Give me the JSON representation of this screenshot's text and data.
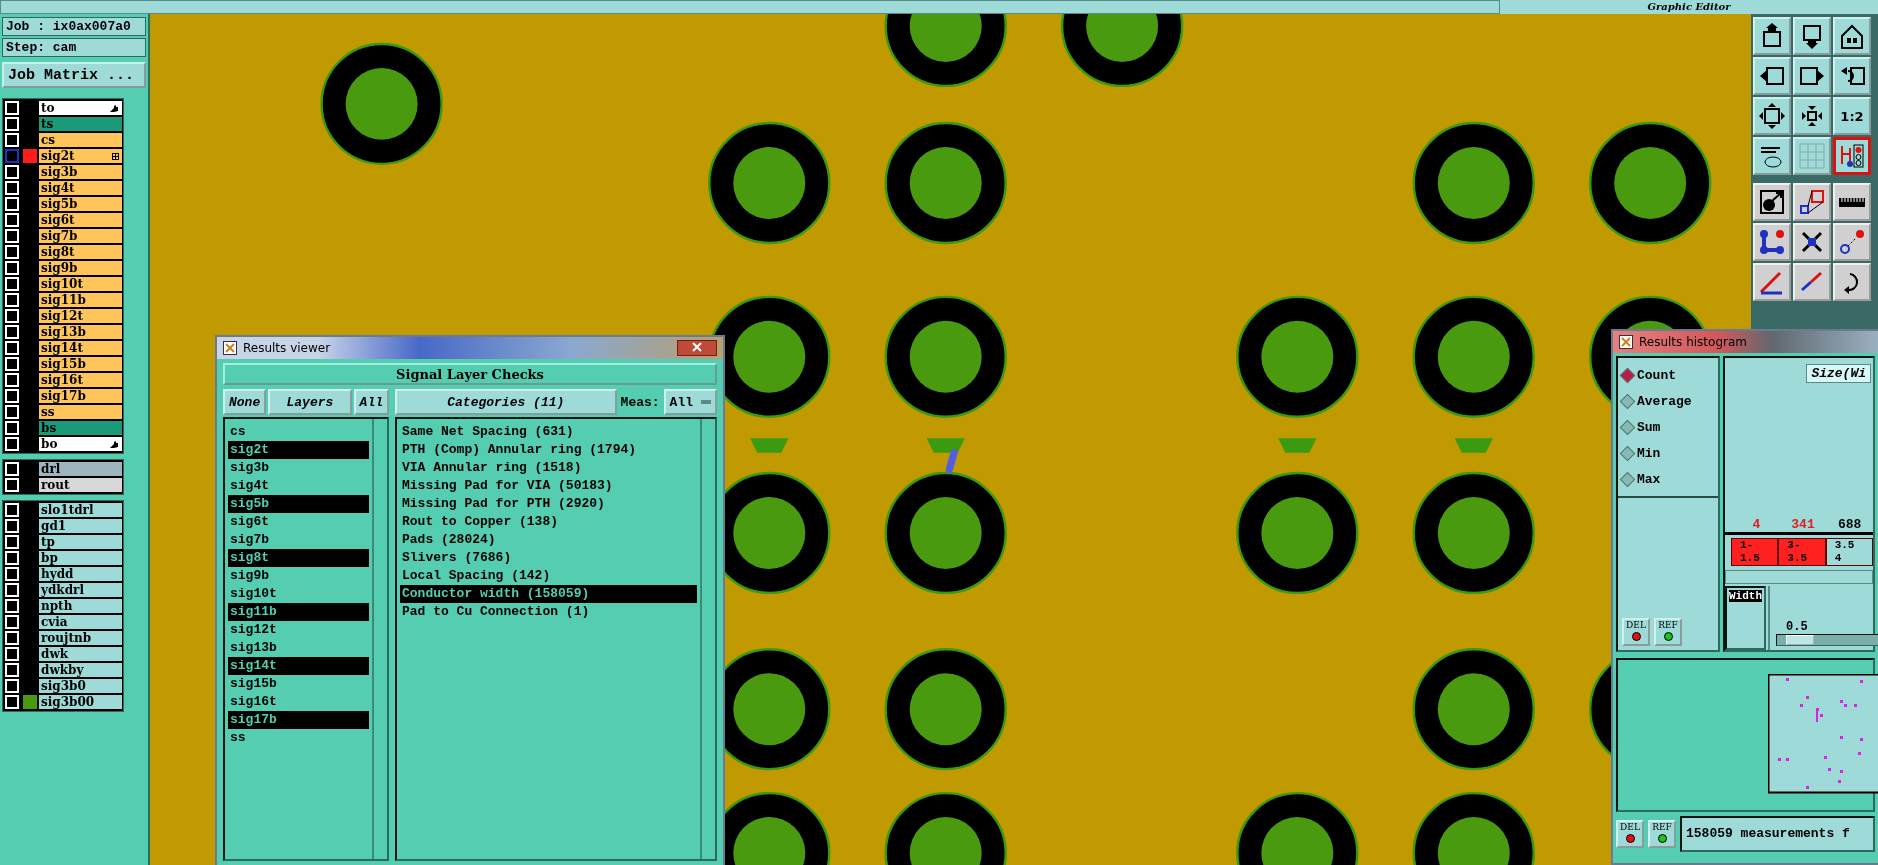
{
  "top_bar": {
    "title": "Graphic Editor"
  },
  "job_panel": {
    "job": "Job : ix0ax007a0",
    "step": "Step: cam",
    "matrix_button": "Job Matrix ...",
    "layer_groups": [
      {
        "layers": [
          {
            "name": "to",
            "color": "#ffffff",
            "checked": false,
            "focused": false,
            "pointer": true
          },
          {
            "name": "ts",
            "color": "#1a9a78",
            "checked": false,
            "focused": false
          },
          {
            "name": "cs",
            "color": "#ffc55a",
            "checked": false,
            "focused": false
          },
          {
            "name": "sig2t",
            "color": "#ffc55a",
            "checked": false,
            "focused": true,
            "swatch": {
              "color": "#ff1c1c"
            },
            "grid_mark": true
          },
          {
            "name": "sig3b",
            "color": "#ffc55a",
            "checked": false,
            "focused": false
          },
          {
            "name": "sig4t",
            "color": "#ffc55a",
            "checked": false,
            "focused": false
          },
          {
            "name": "sig5b",
            "color": "#ffc55a",
            "checked": false,
            "focused": false
          },
          {
            "name": "sig6t",
            "color": "#ffc55a",
            "checked": false,
            "focused": false
          },
          {
            "name": "sig7b",
            "color": "#ffc55a",
            "checked": false,
            "focused": false
          },
          {
            "name": "sig8t",
            "color": "#ffc55a",
            "checked": false,
            "focused": false
          },
          {
            "name": "sig9b",
            "color": "#ffc55a",
            "checked": false,
            "focused": false
          },
          {
            "name": "sig10t",
            "color": "#ffc55a",
            "checked": false,
            "focused": false
          },
          {
            "name": "sig11b",
            "color": "#ffc55a",
            "checked": false,
            "focused": false
          },
          {
            "name": "sig12t",
            "color": "#ffc55a",
            "checked": false,
            "focused": false
          },
          {
            "name": "sig13b",
            "color": "#ffc55a",
            "checked": false,
            "focused": false
          },
          {
            "name": "sig14t",
            "color": "#ffc55a",
            "checked": false,
            "focused": false
          },
          {
            "name": "sig15b",
            "color": "#ffc55a",
            "checked": false,
            "focused": false
          },
          {
            "name": "sig16t",
            "color": "#ffc55a",
            "checked": false,
            "focused": false
          },
          {
            "name": "sig17b",
            "color": "#ffc55a",
            "checked": false,
            "focused": false
          },
          {
            "name": "ss",
            "color": "#ffc55a",
            "checked": false,
            "focused": false
          },
          {
            "name": "bs",
            "color": "#1a9a78",
            "checked": false,
            "focused": false
          },
          {
            "name": "bo",
            "color": "#ffffff",
            "checked": false,
            "focused": false,
            "pointer": true
          }
        ]
      },
      {
        "layers": [
          {
            "name": "drl",
            "color": "#9eb4be",
            "checked": false,
            "focused": false
          },
          {
            "name": "rout",
            "color": "#d8d8d8",
            "checked": false,
            "focused": false
          }
        ]
      },
      {
        "layers": [
          {
            "name": "slo1tdrl",
            "color": "#9ddad8",
            "checked": false,
            "focused": false
          },
          {
            "name": "gd1",
            "color": "#9ddad8",
            "checked": false,
            "focused": false
          },
          {
            "name": "tp",
            "color": "#9ddad8",
            "checked": false,
            "focused": false
          },
          {
            "name": "bp",
            "color": "#9ddad8",
            "checked": false,
            "focused": false
          },
          {
            "name": "hydd",
            "color": "#9ddad8",
            "checked": false,
            "focused": false
          },
          {
            "name": "ydkdrl",
            "color": "#9ddad8",
            "checked": false,
            "focused": false
          },
          {
            "name": "npth",
            "color": "#9ddad8",
            "checked": false,
            "focused": false
          },
          {
            "name": "cvia",
            "color": "#9ddad8",
            "checked": false,
            "focused": false
          },
          {
            "name": "roujtnb",
            "color": "#9ddad8",
            "checked": false,
            "focused": false
          },
          {
            "name": "dwk",
            "color": "#9ddad8",
            "checked": false,
            "focused": false
          },
          {
            "name": "dwkby",
            "color": "#9ddad8",
            "checked": false,
            "focused": false
          },
          {
            "name": "sig3b0",
            "color": "#9ddad8",
            "checked": false,
            "focused": false
          },
          {
            "name": "sig3b00",
            "color": "#9ddad8",
            "checked": false,
            "focused": false,
            "swatch": {
              "color": "#4a9a10"
            }
          }
        ]
      }
    ]
  },
  "toolbar": {
    "tools": [
      {
        "kind": "up",
        "selected": false
      },
      {
        "kind": "down",
        "selected": false
      },
      {
        "kind": "house",
        "selected": false
      },
      {
        "kind": "left",
        "selected": false
      },
      {
        "kind": "right",
        "selected": false
      },
      {
        "kind": "undo",
        "selected": false
      },
      {
        "kind": "expand",
        "selected": false
      },
      {
        "kind": "shrink",
        "selected": false
      },
      {
        "kind": "text",
        "label": "1:2",
        "selected": false
      },
      {
        "kind": "wrench",
        "selected": false
      },
      {
        "kind": "grid",
        "selected": false
      },
      {
        "kind": "network",
        "selected": true
      },
      {
        "kind": "dot-arrow",
        "selected": false
      },
      {
        "kind": "squares",
        "selected": false
      },
      {
        "kind": "ruler",
        "selected": false
      },
      {
        "kind": "nodes",
        "selected": false
      },
      {
        "kind": "cross",
        "selected": false
      },
      {
        "kind": "point-arrow",
        "selected": false
      },
      {
        "kind": "red-line",
        "selected": false
      },
      {
        "kind": "blue-line",
        "selected": false
      },
      {
        "kind": "curve",
        "selected": false
      }
    ]
  },
  "results_viewer": {
    "title": "Results viewer",
    "header": "Signal Layer Checks",
    "buttons": {
      "none": "None",
      "layers": "Layers",
      "all": "All",
      "categories": "Categories (11)",
      "meas_label": "Meas:",
      "meas_value": "All"
    },
    "layers": [
      {
        "name": "cs",
        "selected": false
      },
      {
        "name": "sig2t",
        "selected": true
      },
      {
        "name": "sig3b",
        "selected": false
      },
      {
        "name": "sig4t",
        "selected": false
      },
      {
        "name": "sig5b",
        "selected": true
      },
      {
        "name": "sig6t",
        "selected": false
      },
      {
        "name": "sig7b",
        "selected": false
      },
      {
        "name": "sig8t",
        "selected": true
      },
      {
        "name": "sig9b",
        "selected": false
      },
      {
        "name": "sig10t",
        "selected": false
      },
      {
        "name": "sig11b",
        "selected": true
      },
      {
        "name": "sig12t",
        "selected": false
      },
      {
        "name": "sig13b",
        "selected": false
      },
      {
        "name": "sig14t",
        "selected": true
      },
      {
        "name": "sig15b",
        "selected": false
      },
      {
        "name": "sig16t",
        "selected": false
      },
      {
        "name": "sig17b",
        "selected": true
      },
      {
        "name": "ss",
        "selected": false
      }
    ],
    "categories": [
      {
        "name": "Same Net Spacing (631)",
        "selected": false
      },
      {
        "name": "PTH (Comp) Annular ring (1794)",
        "selected": false
      },
      {
        "name": "VIA Annular ring (1518)",
        "selected": false
      },
      {
        "name": "Missing Pad for VIA (50183)",
        "selected": false
      },
      {
        "name": "Missing Pad for PTH (2920)",
        "selected": false
      },
      {
        "name": "Rout to Copper (138)",
        "selected": false
      },
      {
        "name": "Pads (28024)",
        "selected": false
      },
      {
        "name": "Slivers (7686)",
        "selected": false
      },
      {
        "name": "Local Spacing (142)",
        "selected": false
      },
      {
        "name": "Conductor width (158059)",
        "selected": true
      },
      {
        "name": "Pad to Cu Connection (1)",
        "selected": false
      }
    ]
  },
  "results_histogram": {
    "title": "Results histogram",
    "modes": [
      {
        "label": "Count",
        "selected": true
      },
      {
        "label": "Average",
        "selected": false
      },
      {
        "label": "Sum",
        "selected": false
      },
      {
        "label": "Min",
        "selected": false
      },
      {
        "label": "Max",
        "selected": false
      }
    ],
    "axis_title": "Size(Wi",
    "bins": [
      {
        "count": "4",
        "range": "1-\n1.5",
        "flagged": true
      },
      {
        "count": "341",
        "range": "3-\n3.5",
        "flagged": true
      },
      {
        "count": "688",
        "range": "3.5\n4",
        "flagged": false
      }
    ],
    "measure_list": [
      {
        "label": "Width",
        "selected": true
      }
    ],
    "step_value": "0.5",
    "step_slider": {
      "level": 0.1
    },
    "panel_buttons": {
      "del_label": "DEL",
      "ref_label": "REF"
    },
    "status_buttons": {
      "del_label": "DEL",
      "ref_label": "REF"
    },
    "status": "158059 measurements f"
  }
}
